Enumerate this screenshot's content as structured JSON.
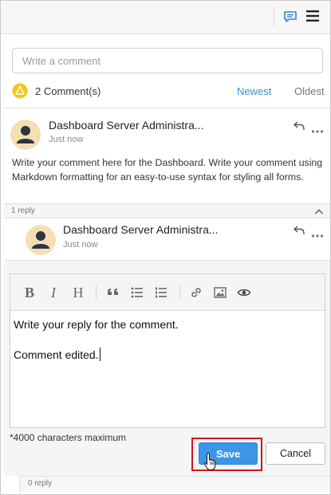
{
  "comment_box": {
    "placeholder": "Write a comment"
  },
  "header": {
    "count_label": "2 Comment(s)",
    "sort_newest": "Newest",
    "sort_oldest": "Oldest"
  },
  "comment": {
    "author": "Dashboard Server Administra...",
    "time": "Just now",
    "body": "Write your comment here for the Dashboard. Write your comment using Markdown formatting for an easy-to-use syntax for styling all forms.",
    "replies_label": "1 reply"
  },
  "reply": {
    "author": "Dashboard Server Administra...",
    "time": "Just now"
  },
  "editor": {
    "toolbar": {
      "bold": "B",
      "italic": "I",
      "heading": "H"
    },
    "line1": "Write your reply for the comment.",
    "line2": "Comment edited.",
    "limit_note": "*4000 characters maximum",
    "save_label": "Save",
    "cancel_label": "Cancel"
  },
  "footer": {
    "replies_label": "0 reply"
  },
  "colors": {
    "accent": "#3a8fd8",
    "save_button": "#3d95e8",
    "highlight": "#d1141b",
    "warning": "#f5c518",
    "avatar_bg": "#f3dfb2"
  },
  "icons": [
    "chat-icon",
    "hamburger-menu-icon",
    "warning-icon",
    "reply-icon",
    "more-icon",
    "chevron-up-icon",
    "quote-icon",
    "bullet-list-icon",
    "numbered-list-icon",
    "link-icon",
    "image-icon",
    "preview-eye-icon",
    "hand-cursor-icon"
  ]
}
